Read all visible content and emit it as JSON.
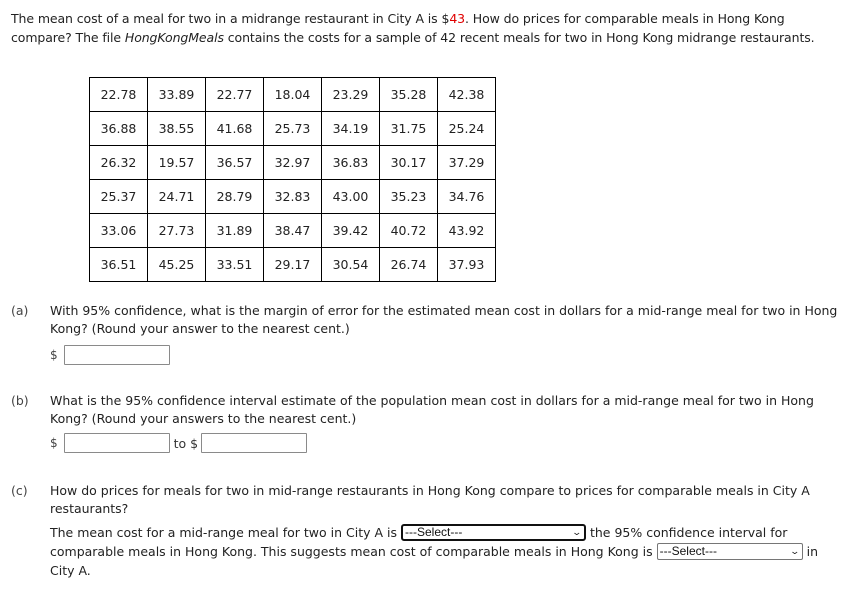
{
  "intro": {
    "part1": "The mean cost of a meal for two in a midrange restaurant in City A is $",
    "highlight": "43",
    "part2": ". How do prices for comparable meals in Hong Kong compare? The file ",
    "filename": "HongKongMeals",
    "part3": " contains the costs for a sample of 42 recent meals for two in Hong Kong midrange restaurants."
  },
  "table": {
    "rows": [
      [
        "22.78",
        "33.89",
        "22.77",
        "18.04",
        "23.29",
        "35.28",
        "42.38"
      ],
      [
        "36.88",
        "38.55",
        "41.68",
        "25.73",
        "34.19",
        "31.75",
        "25.24"
      ],
      [
        "26.32",
        "19.57",
        "36.57",
        "32.97",
        "36.83",
        "30.17",
        "37.29"
      ],
      [
        "25.37",
        "24.71",
        "28.79",
        "32.83",
        "43.00",
        "35.23",
        "34.76"
      ],
      [
        "33.06",
        "27.73",
        "31.89",
        "38.47",
        "39.42",
        "40.72",
        "43.92"
      ],
      [
        "36.51",
        "45.25",
        "33.51",
        "29.17",
        "30.54",
        "26.74",
        "37.93"
      ]
    ]
  },
  "part_a": {
    "label": "(a)",
    "question": "With 95% confidence, what is the margin of error for the estimated mean cost in dollars for a mid-range meal for two in Hong Kong? (Round your answer to the nearest cent.)",
    "currency": "$",
    "answer_value": ""
  },
  "part_b": {
    "label": "(b)",
    "question": "What is the 95% confidence interval estimate of the population mean cost in dollars for a mid-range meal for two in Hong Kong? (Round your answers to the nearest cent.)",
    "currency": "$",
    "to_label": "to $",
    "lower_value": "",
    "upper_value": ""
  },
  "part_c": {
    "label": "(c)",
    "question": "How do prices for meals for two in mid-range restaurants in Hong Kong compare to prices for comparable meals in City A restaurants?",
    "sentence1_pre": "The mean cost for a mid-range meal for two in City A is",
    "select1": "---Select---",
    "sentence1_post": "the 95% confidence interval for comparable meals in Hong Kong. This suggests mean cost of comparable meals in Hong Kong is",
    "select2": "---Select---",
    "sentence2_post": "in City A."
  }
}
